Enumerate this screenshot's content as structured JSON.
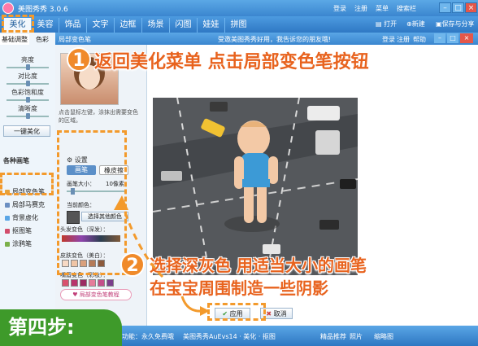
{
  "window": {
    "app_title": "美图秀秀 3.0.6",
    "links": [
      "登录",
      "注册",
      "菜单",
      "搜索栏"
    ]
  },
  "tabs": [
    "美化",
    "美容",
    "饰品",
    "文字",
    "边框",
    "场景",
    "闪图",
    "娃娃",
    "拼图"
  ],
  "toolbar": {
    "open": "打开",
    "new": "新建",
    "save": "保存与分享"
  },
  "left_panel": {
    "subtabs": [
      "基础调整",
      "色彩"
    ],
    "sliders": [
      "亮度",
      "对比度",
      "色彩饱和度",
      "清晰度"
    ],
    "auto_button": "一键美化",
    "section_title": "各种画笔",
    "items": [
      "局部变色笔",
      "局部马赛克",
      "背景虚化",
      "抠图笔",
      "涂鸦笔"
    ]
  },
  "dialog": {
    "title": "局部变色笔",
    "ad_text": "受邀美图秀秀好用，我告诉您的朋友哦!",
    "links": [
      "登录",
      "注册",
      "帮助"
    ],
    "hint": "点击鼠标左键，涂抹出需要变色的区域。",
    "settings_label": "设置",
    "pen_label": "画笔",
    "eraser_label": "橡皮擦",
    "brush_size_label": "画笔大小：",
    "brush_size_value": "10像素",
    "current_color_label": "当前颜色：",
    "choose_color_button": "选择其他颜色",
    "hair_color_label": "头发变色（深发）：",
    "skin_color_label": "皮肤变色（美白）：",
    "lip_color_label": "嘴唇变色（彩妆）：",
    "tutorial_button": "局部变色笔教程",
    "apply_button": "应用",
    "cancel_button": "取消"
  },
  "annotations": {
    "step1_number": "1",
    "step1_text": "返回美化菜单 点击局部变色笔按钮",
    "step2_number": "2",
    "step2_line1": "选择深灰色 用适当大小的画笔",
    "step2_line2": "在宝宝周围制造一些阴影",
    "step_badge": "第四步:"
  },
  "statusbar": {
    "left": "功能：永久免费哦",
    "middle": "美图秀秀AuEvs14 · 美化 · 抠图",
    "right_items": [
      "精品推荐",
      "照片",
      "缩略图"
    ]
  },
  "colors": {
    "accent": "#f08a2a",
    "titlebar": "#3b86cf",
    "badge_green": "#3e9a2a",
    "current_color": "#555555"
  }
}
